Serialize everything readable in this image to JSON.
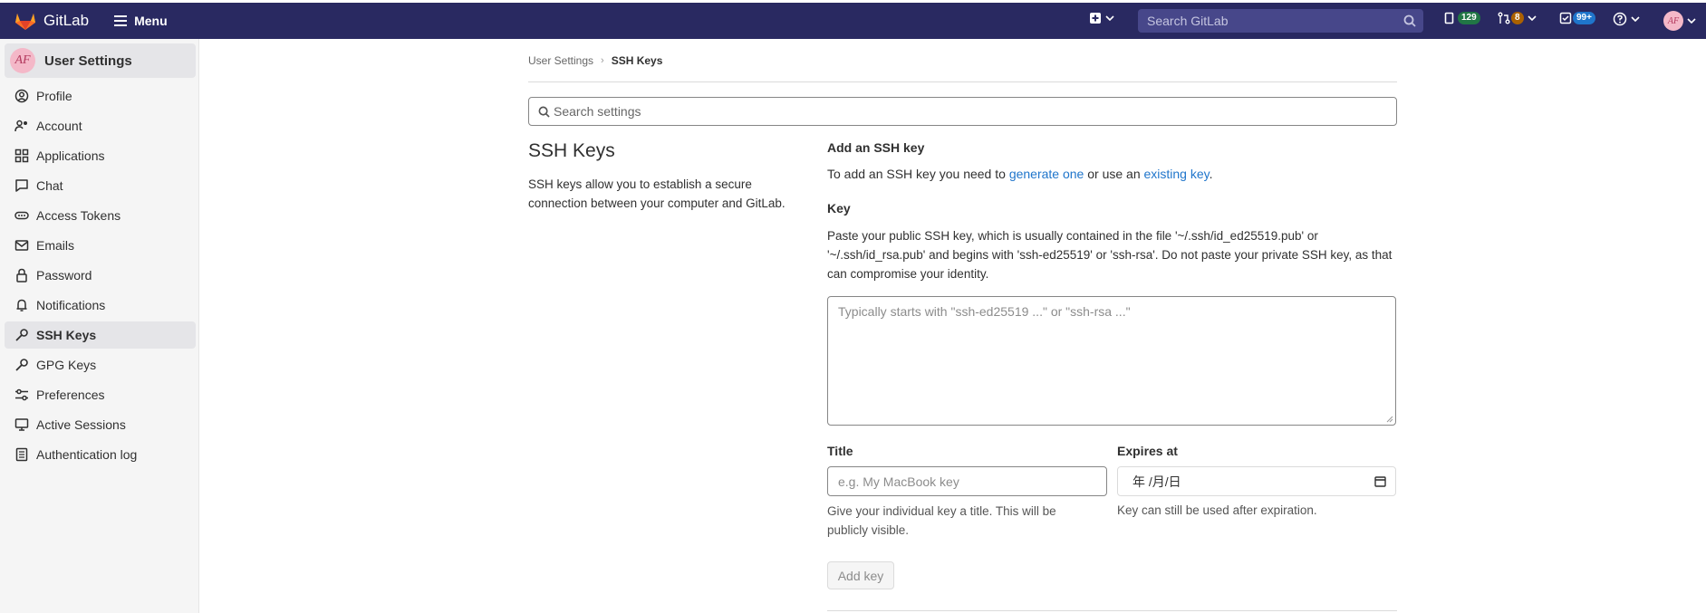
{
  "navbar": {
    "brand": "GitLab",
    "menu_label": "Menu",
    "search_placeholder": "Search GitLab",
    "issues_count": "129",
    "merge_requests_count": "8",
    "todos_count": "99+",
    "avatar_initials": "AF"
  },
  "sidebar": {
    "title": "User Settings",
    "avatar_initials": "AF",
    "items": [
      {
        "label": "Profile",
        "icon": "profile-icon"
      },
      {
        "label": "Account",
        "icon": "account-icon"
      },
      {
        "label": "Applications",
        "icon": "applications-icon"
      },
      {
        "label": "Chat",
        "icon": "chat-icon"
      },
      {
        "label": "Access Tokens",
        "icon": "token-icon"
      },
      {
        "label": "Emails",
        "icon": "mail-icon"
      },
      {
        "label": "Password",
        "icon": "lock-icon"
      },
      {
        "label": "Notifications",
        "icon": "bell-icon"
      },
      {
        "label": "SSH Keys",
        "icon": "key-icon",
        "active": true
      },
      {
        "label": "GPG Keys",
        "icon": "key-icon"
      },
      {
        "label": "Preferences",
        "icon": "preferences-icon"
      },
      {
        "label": "Active Sessions",
        "icon": "monitor-icon"
      },
      {
        "label": "Authentication log",
        "icon": "log-icon"
      }
    ]
  },
  "breadcrumb": {
    "parent": "User Settings",
    "current": "SSH Keys"
  },
  "settings_search_placeholder": "Search settings",
  "section": {
    "title": "SSH Keys",
    "description": "SSH keys allow you to establish a secure connection between your computer and GitLab."
  },
  "form": {
    "heading": "Add an SSH key",
    "intro_prefix": "To add an SSH key you need to ",
    "intro_link1": "generate one",
    "intro_middle": " or use an ",
    "intro_link2": "existing key",
    "intro_suffix": ".",
    "key_label": "Key",
    "key_help": "Paste your public SSH key, which is usually contained in the file '~/.ssh/id_ed25519.pub' or '~/.ssh/id_rsa.pub' and begins with 'ssh-ed25519' or 'ssh-rsa'. Do not paste your private SSH key, as that can compromise your identity.",
    "key_placeholder": "Typically starts with \"ssh-ed25519 ...\" or \"ssh-rsa ...\"",
    "title_label": "Title",
    "title_placeholder": "e.g. My MacBook key",
    "title_help": "Give your individual key a title. This will be publicly visible.",
    "expires_label": "Expires at",
    "expires_value": "年 /月/日",
    "expires_help": "Key can still be used after expiration.",
    "add_button": "Add key"
  },
  "colors": {
    "navbar_bg": "#292961",
    "link": "#1f75cb",
    "sidebar_bg": "#f5f5f5"
  }
}
